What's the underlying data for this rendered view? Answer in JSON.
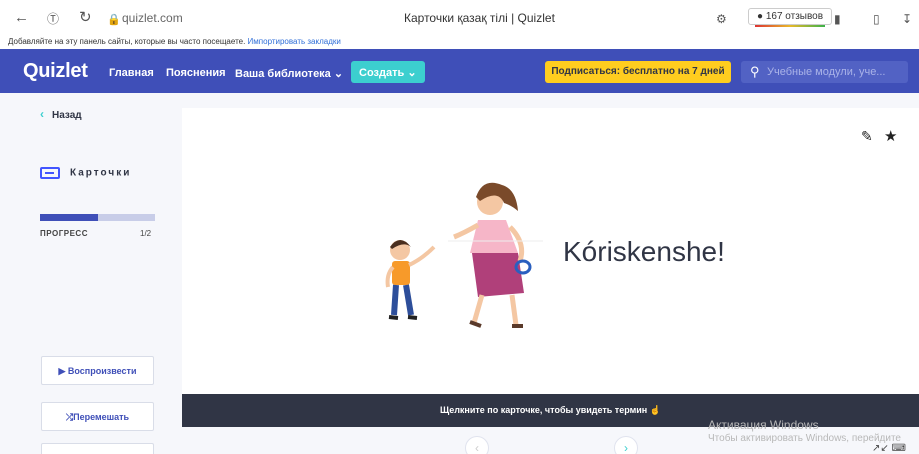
{
  "browser": {
    "url": "quizlet.com",
    "tab_title": "Карточки қазақ тілі | Quizlet",
    "reviews": "167 отзывов",
    "bookmarks_prompt": "Добавляйте на эту панель сайты, которые вы часто посещаете.",
    "bookmarks_link": "Импортировать закладки"
  },
  "header": {
    "logo": "Quizlet",
    "nav": [
      "Главная",
      "Пояснения",
      "Ваша библиотека"
    ],
    "create_label": "Создать",
    "subscribe_label": "Подписаться: бесплатно на 7 дней",
    "search_placeholder": "Учебные модули, уче..."
  },
  "sidebar": {
    "back_label": "Назад",
    "mode_label": "Карточки",
    "progress_label": "ПРОГРЕСС",
    "progress_count": "1/2",
    "progress_fraction": 0.5,
    "play_label": "Воспроизвести",
    "shuffle_label": "Перемешать"
  },
  "card": {
    "term": "Kóriskenshe!",
    "hint": "Щелкните по карточке, чтобы увидеть термин"
  },
  "watermark": {
    "title": "Активация Windows",
    "subtitle": "Чтобы активировать Windows, перейдите"
  },
  "colors": {
    "header_bg": "#3f4fb8",
    "create_bg": "#3ccfcf",
    "subscribe_bg": "#ffcd1f",
    "hint_bg": "#303545"
  },
  "icons": [
    "back-arrow-icon",
    "reload-icon",
    "lock-icon",
    "search-icon",
    "card-icon",
    "edit-icon",
    "star-icon",
    "play-icon",
    "shuffle-icon"
  ]
}
